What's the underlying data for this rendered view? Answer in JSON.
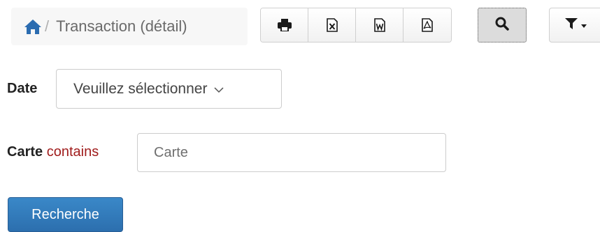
{
  "breadcrumb": {
    "home_icon": "home-icon",
    "separator": "/",
    "current": "Transaction (détail)",
    "home_color": "#2b6cb0"
  },
  "toolbar": {
    "buttons": [
      {
        "name": "print",
        "icon": "print-icon"
      },
      {
        "name": "excel",
        "icon": "excel-icon"
      },
      {
        "name": "word",
        "icon": "word-icon"
      },
      {
        "name": "pdf",
        "icon": "pdf-icon"
      }
    ],
    "search_icon": "search-icon",
    "filter_icon": "filter-icon"
  },
  "form": {
    "date": {
      "label": "Date",
      "select_value": "Veuillez sélectionner"
    },
    "carte": {
      "label": "Carte",
      "operator": "contains",
      "placeholder": "Carte",
      "value": ""
    },
    "submit_label": "Recherche"
  },
  "colors": {
    "primary_button": "#337ab7",
    "operator_text": "#a01c1c"
  }
}
